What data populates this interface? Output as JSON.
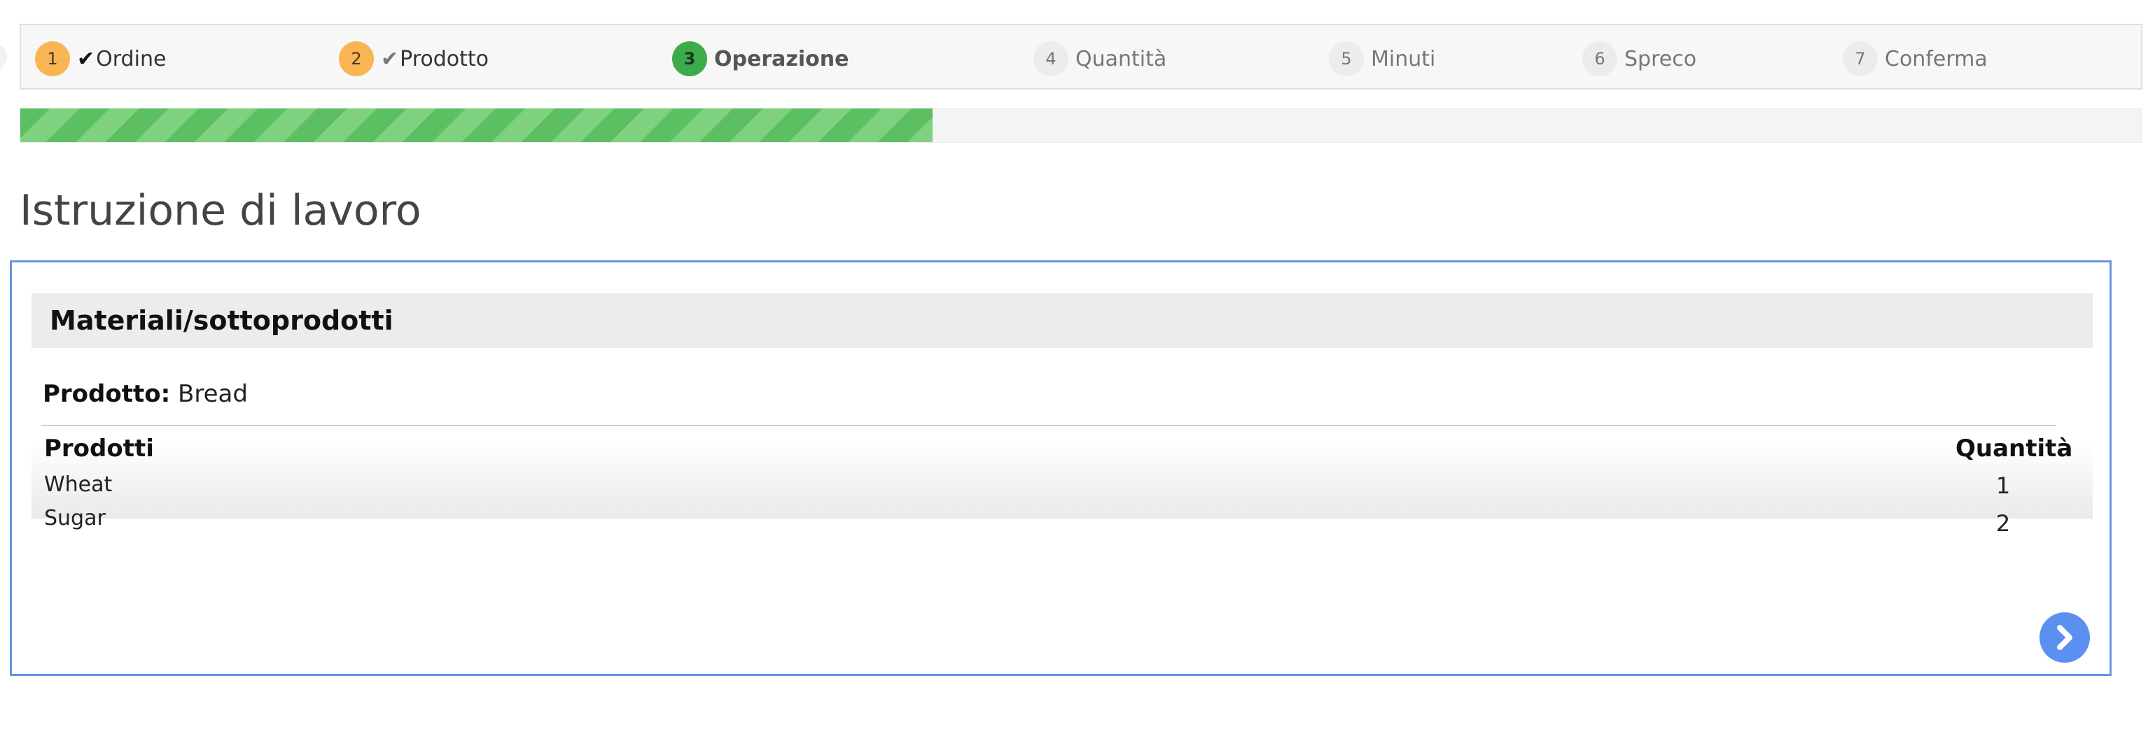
{
  "stepper": {
    "steps": [
      {
        "number": "1",
        "label": "Ordine",
        "state": "done",
        "check": "✔"
      },
      {
        "number": "2",
        "label": "Prodotto",
        "state": "done",
        "check": "✔"
      },
      {
        "number": "3",
        "label": "Operazione",
        "state": "current"
      },
      {
        "number": "4",
        "label": "Quantità",
        "state": "future"
      },
      {
        "number": "5",
        "label": "Minuti",
        "state": "future"
      },
      {
        "number": "6",
        "label": "Spreco",
        "state": "future"
      },
      {
        "number": "7",
        "label": "Conferma",
        "state": "future"
      }
    ]
  },
  "progress": {
    "percent": 43
  },
  "page": {
    "title": "Istruzione di lavoro"
  },
  "panel": {
    "heading": "Materiali/sottoprodotti",
    "product_label": "Prodotto:",
    "product_value": "Bread",
    "columns": {
      "products": "Prodotti",
      "quantity": "Quantità"
    },
    "rows": [
      {
        "name": "Wheat",
        "qty": "1"
      },
      {
        "name": "Sugar",
        "qty": "2"
      }
    ],
    "next_icon": "chevron-right-icon"
  },
  "colors": {
    "done_step": "#f9b553",
    "current_step": "#3daa4c",
    "progress": "#5cbf62",
    "panel_border": "#6a94de",
    "next_button": "#5b8ff0"
  }
}
